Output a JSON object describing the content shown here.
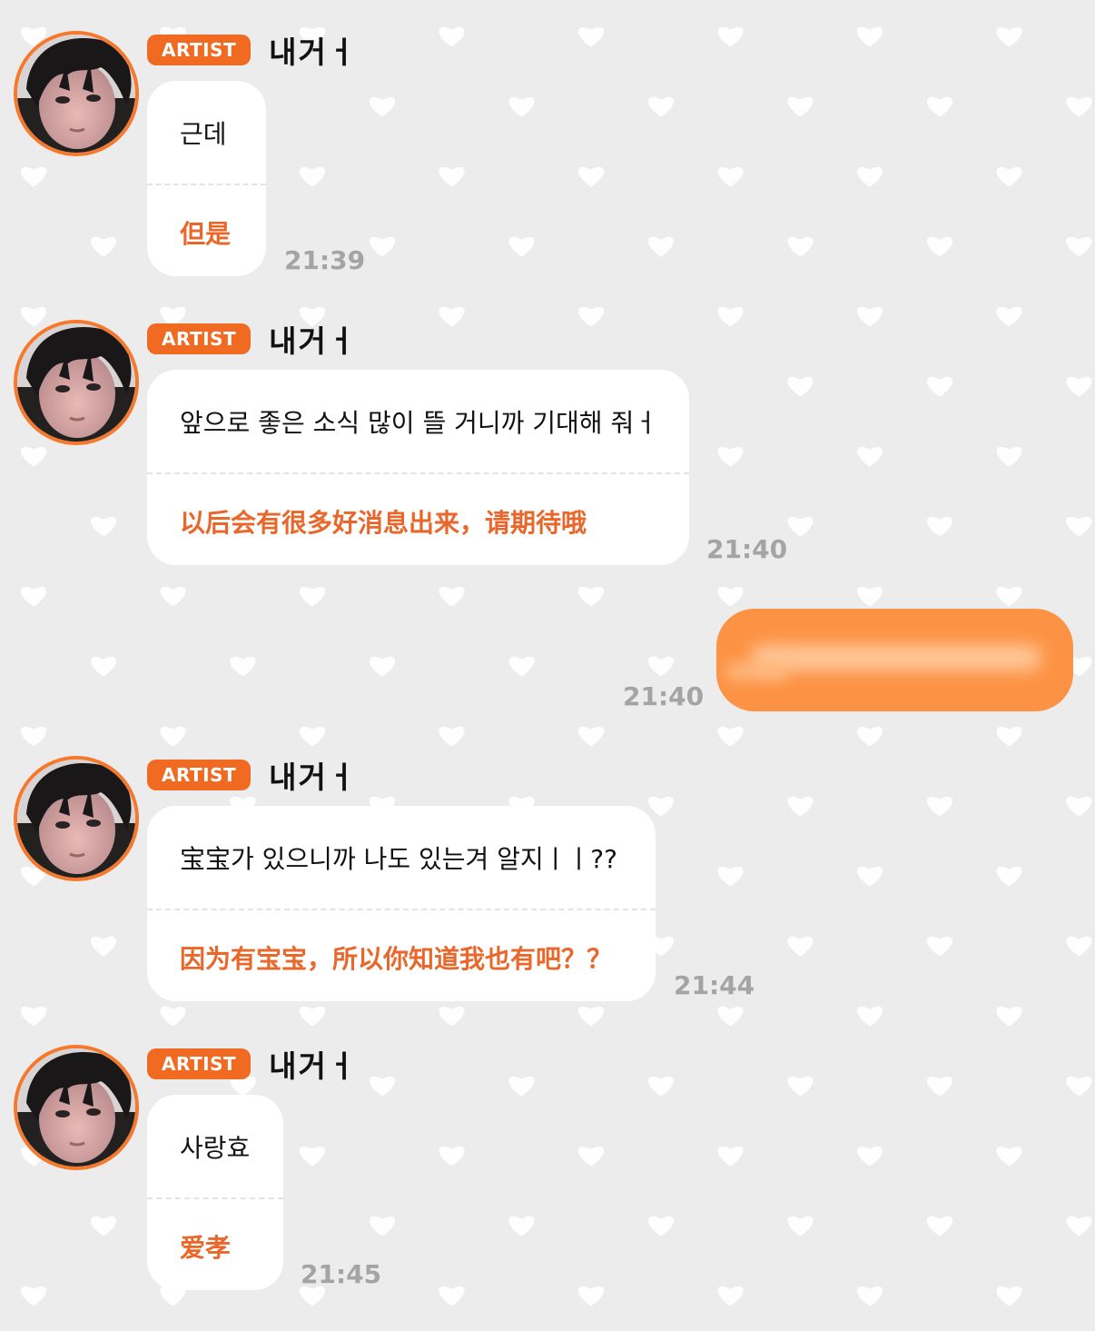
{
  "chat": {
    "theme": {
      "accent": "#f06a22",
      "translation_color": "#e9672a",
      "my_bubble_color": "#fc9344",
      "background": "#ececec",
      "pattern": "white-hearts"
    },
    "messages": [
      {
        "badge": "ARTIST",
        "sender": "내거ㅓ",
        "text": "근데",
        "translation": "但是",
        "time": "21:39"
      },
      {
        "badge": "ARTIST",
        "sender": "내거ㅓ",
        "text": "앞으로 좋은 소식 많이 뜰 거니까 기대해 줘ㅓ",
        "translation": "以后会有很多好消息出来，请期待哦",
        "time": "21:40"
      },
      {
        "outgoing": true,
        "text_blurred": true,
        "time": "21:40"
      },
      {
        "badge": "ARTIST",
        "sender": "내거ㅓ",
        "text": "宝宝가 있으니까 나도 있는겨 알지ㅣㅣ??",
        "translation": "因为有宝宝，所以你知道我也有吧？？",
        "time": "21:44"
      },
      {
        "badge": "ARTIST",
        "sender": "내거ㅓ",
        "text": "사랑효",
        "translation": "爱孝",
        "time": "21:45"
      }
    ]
  }
}
